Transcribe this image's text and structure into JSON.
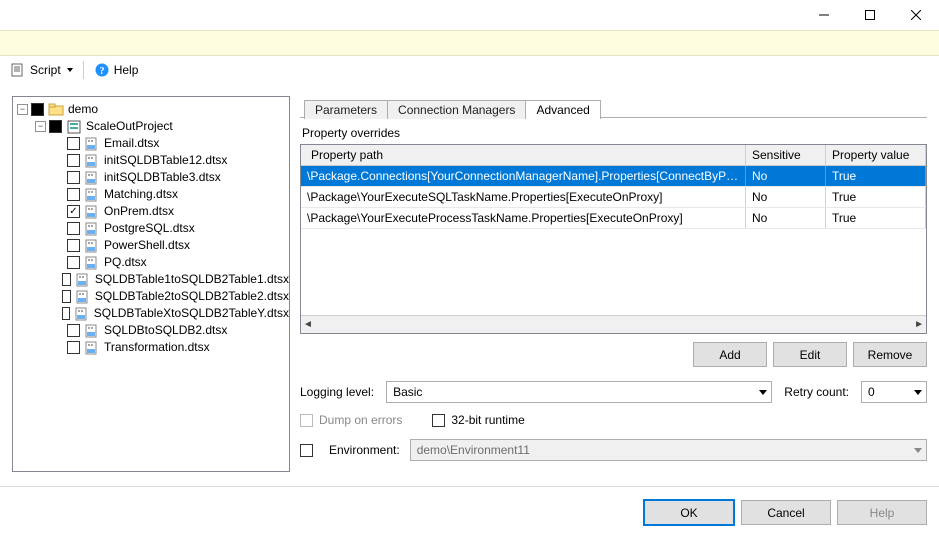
{
  "toolbar": {
    "script_label": "Script",
    "help_label": "Help"
  },
  "tree": {
    "root": "demo",
    "project": "ScaleOutProject",
    "packages": [
      "Email.dtsx",
      "initSQLDBTable12.dtsx",
      "initSQLDBTable3.dtsx",
      "Matching.dtsx",
      "OnPrem.dtsx",
      "PostgreSQL.dtsx",
      "PowerShell.dtsx",
      "PQ.dtsx",
      "SQLDBTable1toSQLDB2Table1.dtsx",
      "SQLDBTable2toSQLDB2Table2.dtsx",
      "SQLDBTableXtoSQLDB2TableY.dtsx",
      "SQLDBtoSQLDB2.dtsx",
      "Transformation.dtsx"
    ],
    "checked_index": 4
  },
  "tabs": {
    "parameters": "Parameters",
    "conn_mgrs": "Connection Managers",
    "advanced": "Advanced"
  },
  "overrides": {
    "label": "Property overrides",
    "columns": {
      "path": "Property path",
      "sensitive": "Sensitive",
      "value": "Property value"
    },
    "rows": [
      {
        "path": "\\Package.Connections[YourConnectionManagerName].Properties[ConnectByProxy]",
        "sensitive": "No",
        "value": "True"
      },
      {
        "path": "\\Package\\YourExecuteSQLTaskName.Properties[ExecuteOnProxy]",
        "sensitive": "No",
        "value": "True"
      },
      {
        "path": "\\Package\\YourExecuteProcessTaskName.Properties[ExecuteOnProxy]",
        "sensitive": "No",
        "value": "True"
      }
    ],
    "buttons": {
      "add": "Add",
      "edit": "Edit",
      "remove": "Remove"
    }
  },
  "options": {
    "logging_label": "Logging level:",
    "logging_value": "Basic",
    "retry_label": "Retry count:",
    "retry_value": "0",
    "dump_label": "Dump on errors",
    "runtime32_label": "32-bit runtime"
  },
  "environment": {
    "label": "Environment:",
    "value": "demo\\Environment11"
  },
  "footer": {
    "ok": "OK",
    "cancel": "Cancel",
    "help": "Help"
  }
}
